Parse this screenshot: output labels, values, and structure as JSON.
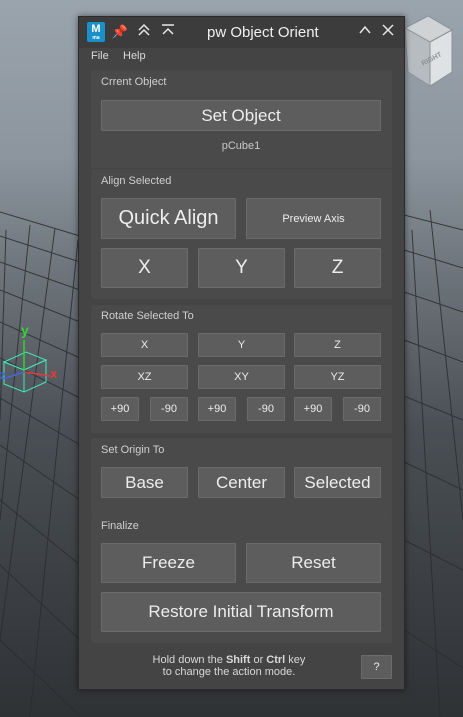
{
  "window": {
    "title": "pw Object Orient",
    "app_logo_letter": "M",
    "app_logo_caption": "ma"
  },
  "menu": {
    "file": "File",
    "help": "Help"
  },
  "current_object": {
    "label": "Crrent Object",
    "set_button": "Set Object",
    "value": "pCube1"
  },
  "align_selected": {
    "label": "Align Selected",
    "quick_align": "Quick Align",
    "preview_axis": "Preview Axis",
    "x": "X",
    "y": "Y",
    "z": "Z"
  },
  "rotate_selected": {
    "label": "Rotate Selected To",
    "row1": [
      "X",
      "Y",
      "Z"
    ],
    "row2": [
      "XZ",
      "XY",
      "YZ"
    ],
    "row3": [
      "+90",
      "-90",
      "+90",
      "-90",
      "+90",
      "-90"
    ]
  },
  "set_origin": {
    "label": "Set Origin To",
    "base": "Base",
    "center": "Center",
    "selected": "Selected"
  },
  "finalize": {
    "label": "Finalize",
    "freeze": "Freeze",
    "reset": "Reset",
    "restore": "Restore Initial Transform"
  },
  "footer": {
    "hint_prefix": "Hold down the ",
    "shift": "Shift",
    "or": " or ",
    "ctrl": "Ctrl",
    "hint_suffix": " key",
    "hint_line2": "to change the action mode.",
    "help_button": "?"
  },
  "viewport": {
    "axis_y": "y",
    "axis_x": "x",
    "axis_z": "z",
    "viewcube_label": "RIGHT"
  },
  "colors": {
    "window_bg": "#444444",
    "section_bg": "#4a4a4a",
    "button_bg": "#5d5d5d",
    "axis_x": "#e33b3b",
    "axis_y": "#35d235",
    "axis_z": "#3b6be3"
  }
}
